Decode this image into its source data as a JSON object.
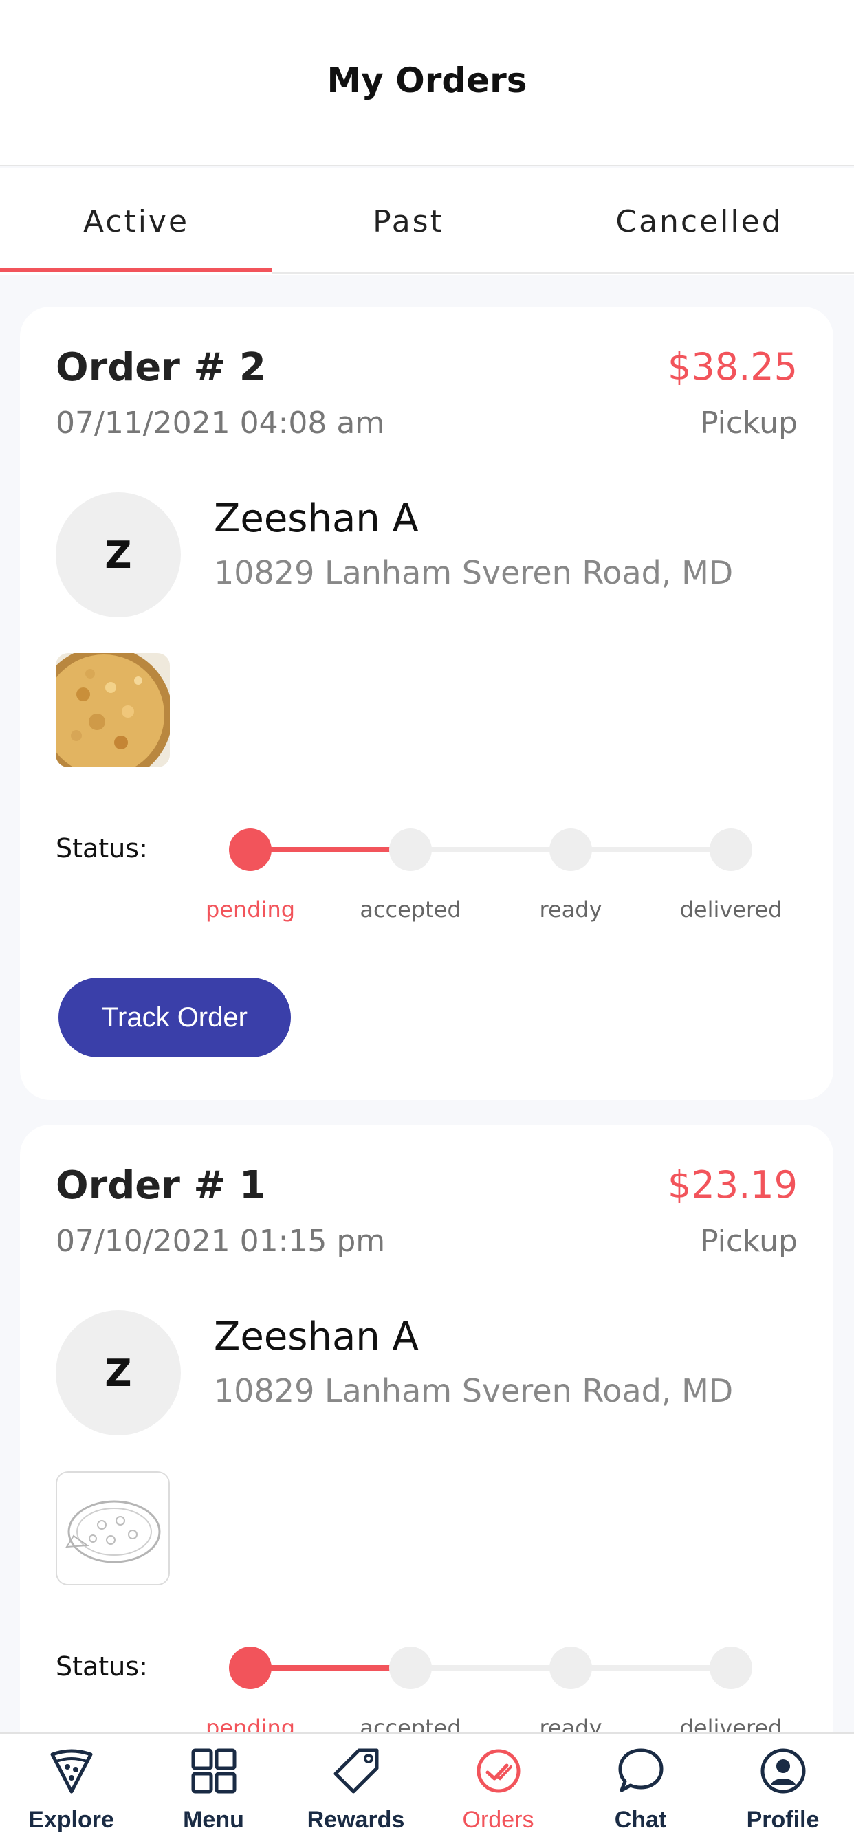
{
  "header": {
    "title": "My Orders"
  },
  "tabs": [
    {
      "label": "Active"
    },
    {
      "label": "Past"
    },
    {
      "label": "Cancelled"
    }
  ],
  "orders": [
    {
      "title": "Order # 2",
      "price": "$38.25",
      "date": "07/11/2021 04:08 am",
      "type": "Pickup",
      "avatar_initial": "Z",
      "customer_name": "Zeeshan A",
      "address": "10829 Lanham Sveren Road, MD",
      "status_label": "Status:",
      "steps": [
        "pending",
        "accepted",
        "ready",
        "delivered"
      ],
      "track_label": "Track Order"
    },
    {
      "title": "Order # 1",
      "price": "$23.19",
      "date": "07/10/2021 01:15 pm",
      "type": "Pickup",
      "avatar_initial": "Z",
      "customer_name": "Zeeshan A",
      "address": "10829 Lanham Sveren Road, MD",
      "status_label": "Status:",
      "steps": [
        "pending",
        "accepted",
        "ready",
        "delivered"
      ]
    }
  ],
  "nav": [
    {
      "label": "Explore",
      "icon": "pizza-slice-icon"
    },
    {
      "label": "Menu",
      "icon": "grid-icon"
    },
    {
      "label": "Rewards",
      "icon": "tag-icon"
    },
    {
      "label": "Orders",
      "icon": "orders-check-icon"
    },
    {
      "label": "Chat",
      "icon": "chat-bubble-icon"
    },
    {
      "label": "Profile",
      "icon": "user-circle-icon"
    }
  ],
  "colors": {
    "accent": "#f2545b",
    "button": "#3a3fa9",
    "nav_text": "#1a2b44"
  }
}
